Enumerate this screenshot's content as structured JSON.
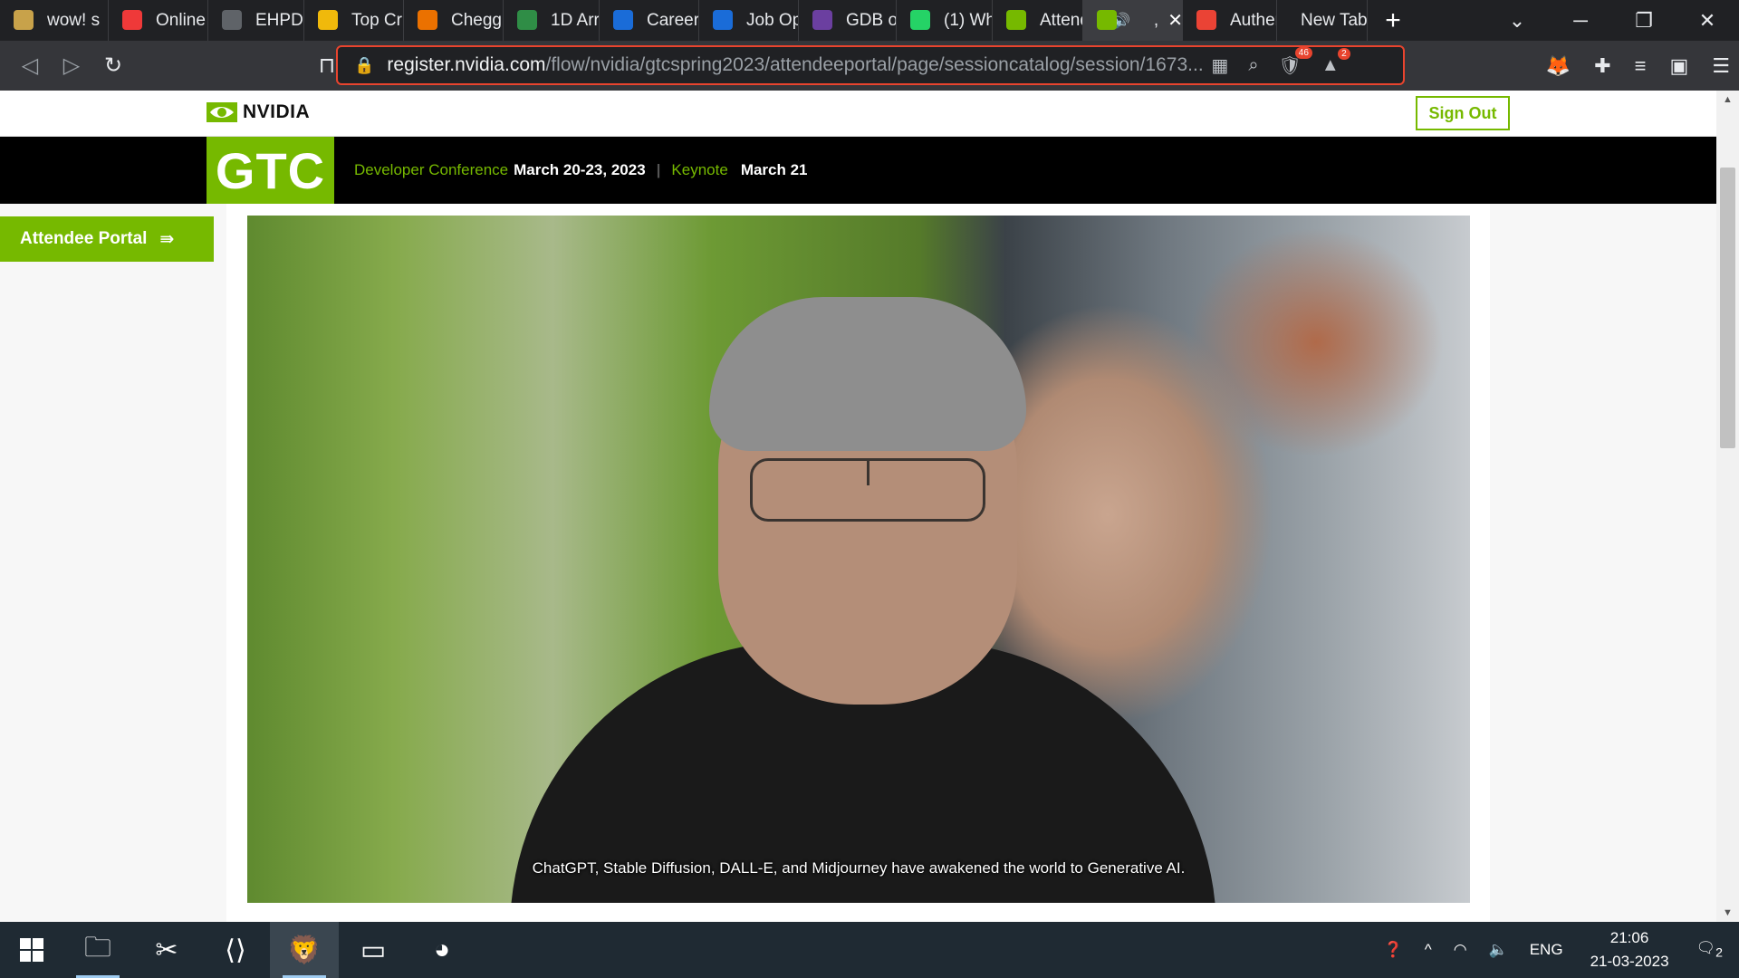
{
  "browser": {
    "tabs": [
      {
        "label": "wow! s",
        "icon": "doge-icon",
        "color": "#c8a24a",
        "width": 120
      },
      {
        "label": "Online",
        "icon": "vivaldi-icon",
        "color": "#ef3939",
        "width": 110
      },
      {
        "label": "EHPD",
        "icon": "globe-icon",
        "color": "#5f6368",
        "width": 106
      },
      {
        "label": "Top Cr",
        "icon": "binance-icon",
        "color": "#f0b90b",
        "width": 110
      },
      {
        "label": "Chegg",
        "icon": "chegg-icon",
        "color": "#eb7100",
        "width": 110
      },
      {
        "label": "1D Arr",
        "icon": "coding-icon",
        "color": "#2f8d46",
        "width": 106
      },
      {
        "label": "Career",
        "icon": "bluebox-icon",
        "color": "#1a6cd8",
        "width": 110
      },
      {
        "label": "Job Op",
        "icon": "bluebox-icon",
        "color": "#1a6cd8",
        "width": 110
      },
      {
        "label": "GDB o",
        "icon": "bolt-icon",
        "color": "#6b3fa0",
        "width": 108
      },
      {
        "label": "(1) Wh",
        "icon": "whatsapp-icon",
        "color": "#25d366",
        "width": 106
      },
      {
        "label": "Attend",
        "icon": "nvidia-icon",
        "color": "#76b900",
        "width": 100
      },
      {
        "label": ",",
        "icon": "nvidia-icon",
        "color": "#76b900",
        "width": 110,
        "active": true
      },
      {
        "label": "Auther",
        "icon": "gmail-icon",
        "color": "#ea4335",
        "width": 104
      },
      {
        "label": "New Tab",
        "icon": "",
        "color": "#202124",
        "width": 100
      }
    ],
    "url_host": "register.nvidia.com",
    "url_path": "/flow/nvidia/gtcspring2023/attendeeportal/page/sessioncatalog/session/1673...",
    "brave_shield_count": "46",
    "rewards_count": "2"
  },
  "page": {
    "brand": "NVIDIA",
    "sign_out": "Sign Out",
    "gtc_logo": "GTC",
    "event_label": "Developer Conference",
    "event_dates": "March 20-23, 2023",
    "keynote_label": "Keynote",
    "keynote_date": "March 21",
    "portal_button": "Attendee Portal",
    "video_caption": "ChatGPT, Stable Diffusion, DALL-E, and Midjourney have awakened the world to Generative AI."
  },
  "taskbar": {
    "apps": [
      {
        "name": "file-explorer-icon",
        "glyph": "🗀",
        "running": true,
        "active": false
      },
      {
        "name": "snipping-tool-icon",
        "glyph": "✂",
        "running": false,
        "active": false
      },
      {
        "name": "vscode-icon",
        "glyph": "⟨⟩",
        "running": false,
        "active": false
      },
      {
        "name": "brave-icon",
        "glyph": "🦁",
        "running": true,
        "active": true
      },
      {
        "name": "terminal-icon",
        "glyph": "▭",
        "running": false,
        "active": false
      },
      {
        "name": "edge-icon",
        "glyph": "◕",
        "running": false,
        "active": false
      }
    ],
    "language": "ENG",
    "time": "21:06",
    "date": "21-03-2023",
    "notifications": "2"
  },
  "colors": {
    "nvidia_green": "#76b900",
    "tab_bg": "#202124",
    "toolbar_bg": "#35363a",
    "taskbar_bg": "#1f2a33"
  }
}
